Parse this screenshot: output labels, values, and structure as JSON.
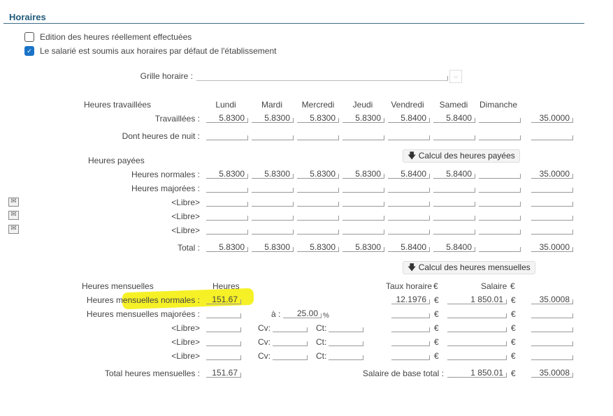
{
  "section_title": "Horaires",
  "checkboxes": [
    {
      "label": "Edition des heures réellement effectuées",
      "checked": false
    },
    {
      "label": "Le salarié est soumis aux horaires par défaut de l'établissement",
      "checked": true
    }
  ],
  "grille": {
    "label": "Grille horaire :",
    "value": ""
  },
  "worked": {
    "heading": "Heures travaillées",
    "days": [
      "Lundi",
      "Mardi",
      "Mercredi",
      "Jeudi",
      "Vendredi",
      "Samedi",
      "Dimanche"
    ],
    "rows": [
      {
        "label": "Travaillées :",
        "values": [
          "5.8300",
          "5.8300",
          "5.8300",
          "5.8300",
          "5.8400",
          "5.8400",
          "",
          "35.0000"
        ]
      },
      {
        "label": "Dont heures de nuit :",
        "values": [
          "",
          "",
          "",
          "",
          "",
          "",
          "",
          ""
        ]
      }
    ]
  },
  "paid": {
    "heading": "Heures payées",
    "calc_button": "Calcul des heures payées",
    "rows": [
      {
        "label": "Heures normales :",
        "values": [
          "5.8300",
          "5.8300",
          "5.8300",
          "5.8300",
          "5.8400",
          "5.8400",
          "",
          "35.0000"
        ]
      },
      {
        "label": "Heures majorées :",
        "values": [
          "",
          "",
          "",
          "",
          "",
          "",
          "",
          ""
        ]
      },
      {
        "label": "<Libre>",
        "values": [
          "",
          "",
          "",
          "",
          "",
          "",
          "",
          ""
        ]
      },
      {
        "label": "<Libre>",
        "values": [
          "",
          "",
          "",
          "",
          "",
          "",
          "",
          ""
        ]
      },
      {
        "label": "<Libre>",
        "values": [
          "",
          "",
          "",
          "",
          "",
          "",
          "",
          ""
        ]
      },
      {
        "label": "Total :",
        "values": [
          "5.8300",
          "5.8300",
          "5.8300",
          "5.8300",
          "5.8400",
          "5.8400",
          "",
          "35.0000"
        ]
      }
    ]
  },
  "monthly": {
    "heading": "Heures mensuelles",
    "calc_button": "Calcul des heures mensuelles",
    "col_heures": "Heures",
    "col_taux": "Taux horaire",
    "col_salaire": "Salaire",
    "currency": "€",
    "a_label": "à :",
    "a_value": "25.00",
    "percent": "%",
    "cv_label": "Cv:",
    "ct_label": "Ct:",
    "rows": [
      {
        "label": "Heures mensuelles normales :",
        "heures": "151.67",
        "taux": "12.1976",
        "salaire": "1 850.01",
        "last": "35.0008"
      },
      {
        "label": "Heures mensuelles majorées :",
        "heures": "",
        "taux": "",
        "salaire": "",
        "last": ""
      },
      {
        "label": "<Libre>",
        "heures": "",
        "taux": "",
        "salaire": "",
        "last": ""
      },
      {
        "label": "<Libre>",
        "heures": "",
        "taux": "",
        "salaire": "",
        "last": ""
      },
      {
        "label": "<Libre>",
        "heures": "",
        "taux": "",
        "salaire": "",
        "last": ""
      }
    ],
    "total_label": "Total heures mensuelles :",
    "total_heures": "151.67",
    "salaire_total_label": "Salaire de base total :",
    "salaire_total": "1 850.01",
    "total_last": "35.0008"
  },
  "highlight_color": "#f5ef00"
}
